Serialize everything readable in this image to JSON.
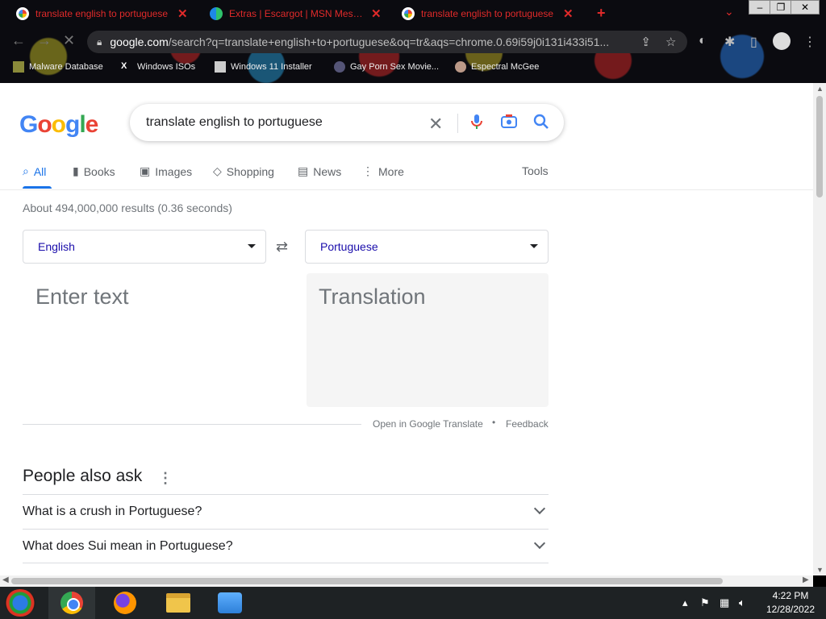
{
  "browser": {
    "tabs": [
      {
        "title": "translate english to portuguese"
      },
      {
        "title": "Extras | Escargot | MSN Messenger"
      },
      {
        "title": "translate english to portuguese"
      }
    ],
    "url_domain": "google.com",
    "url_rest": "/search?q=translate+english+to+portuguese&oq=tr&aqs=chrome.0.69i59j0i131i433i51...",
    "bookmarks": [
      {
        "label": "Malware Database"
      },
      {
        "label": "Windows ISOs"
      },
      {
        "label": "Windows 11 Installer"
      },
      {
        "label": "Gay Porn Sex Movie..."
      },
      {
        "label": "Espectral McGee"
      }
    ]
  },
  "google": {
    "logo_letters": [
      "G",
      "o",
      "o",
      "g",
      "l",
      "e"
    ],
    "query": "translate english to portuguese",
    "nav_tabs": [
      {
        "label": "All"
      },
      {
        "label": "Books"
      },
      {
        "label": "Images"
      },
      {
        "label": "Shopping"
      },
      {
        "label": "News"
      },
      {
        "label": "More"
      }
    ],
    "tools_label": "Tools",
    "result_stats": "About 494,000,000 results (0.36 seconds)"
  },
  "translator": {
    "source_language": "English",
    "target_language": "Portuguese",
    "source_placeholder": "Enter text",
    "translation_placeholder": "Translation",
    "open_link": "Open in Google Translate",
    "separator": "•",
    "feedback_link": "Feedback"
  },
  "people_also_ask": {
    "title": "People also ask",
    "questions": [
      "What is a crush in Portuguese?",
      "What does Sui mean in Portuguese?"
    ]
  },
  "taskbar": {
    "clock_time": "4:22 PM",
    "clock_date": "12/28/2022"
  },
  "colors": {
    "accent_blue": "#1a73e8",
    "link_blue": "#1a0dab",
    "tab_red": "#e02a2a"
  }
}
